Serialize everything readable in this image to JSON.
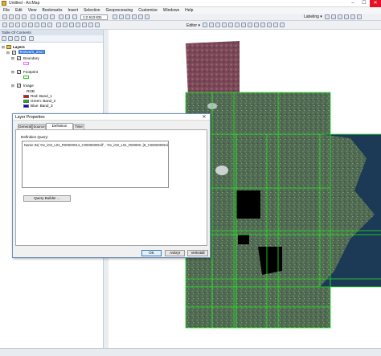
{
  "window": {
    "title": "Untitled - ArcMap",
    "minimize": "–",
    "maximize": "☐",
    "close": "✕"
  },
  "menu": [
    "File",
    "Edit",
    "View",
    "Bookmarks",
    "Insert",
    "Selection",
    "Geoprocessing",
    "Customize",
    "Windows",
    "Help"
  ],
  "toolbar": {
    "scale": "1:2 613 831",
    "editor_label": "Editor ▾",
    "labeling_label": "Labeling ▾"
  },
  "toc": {
    "title": "Table Of Contents",
    "root": "Layers",
    "group": "Testwa/0_2017",
    "layers": [
      {
        "name": "Boundary",
        "swatch_color": "#ff66ff"
      },
      {
        "name": "Footprint",
        "swatch_color": "#66ff66"
      },
      {
        "name": "Image"
      }
    ],
    "image_legend_title": "RGB",
    "bands": [
      {
        "name": "Red:   Band_1",
        "color": "#ff0000"
      },
      {
        "name": "Green: Band_2",
        "color": "#00cc00"
      },
      {
        "name": "Blue:  Band_3",
        "color": "#0000ff"
      }
    ]
  },
  "dialog": {
    "title": "Layer Properties",
    "close": "✕",
    "tabs": [
      "General",
      "Source",
      "Definition Query",
      "Time"
    ],
    "active_tab": "Definition Query",
    "definition_query_label": "Definition Query:",
    "query_text": "Name IN( 'Ov_iO2_L01_R00000014_C00000009.tif' , 'Ov_iO2_L01_R00000..(8_C00000009.tif' )",
    "query_builder": "Query Builder ...",
    "ok": "OK",
    "cancel": "Avbryt",
    "apply": "Verkställ"
  },
  "colors": {
    "footprint_lines": "#22ee22",
    "black_nodata": "#000000",
    "water": "#1c3a55",
    "terrain": "#4e6650"
  }
}
